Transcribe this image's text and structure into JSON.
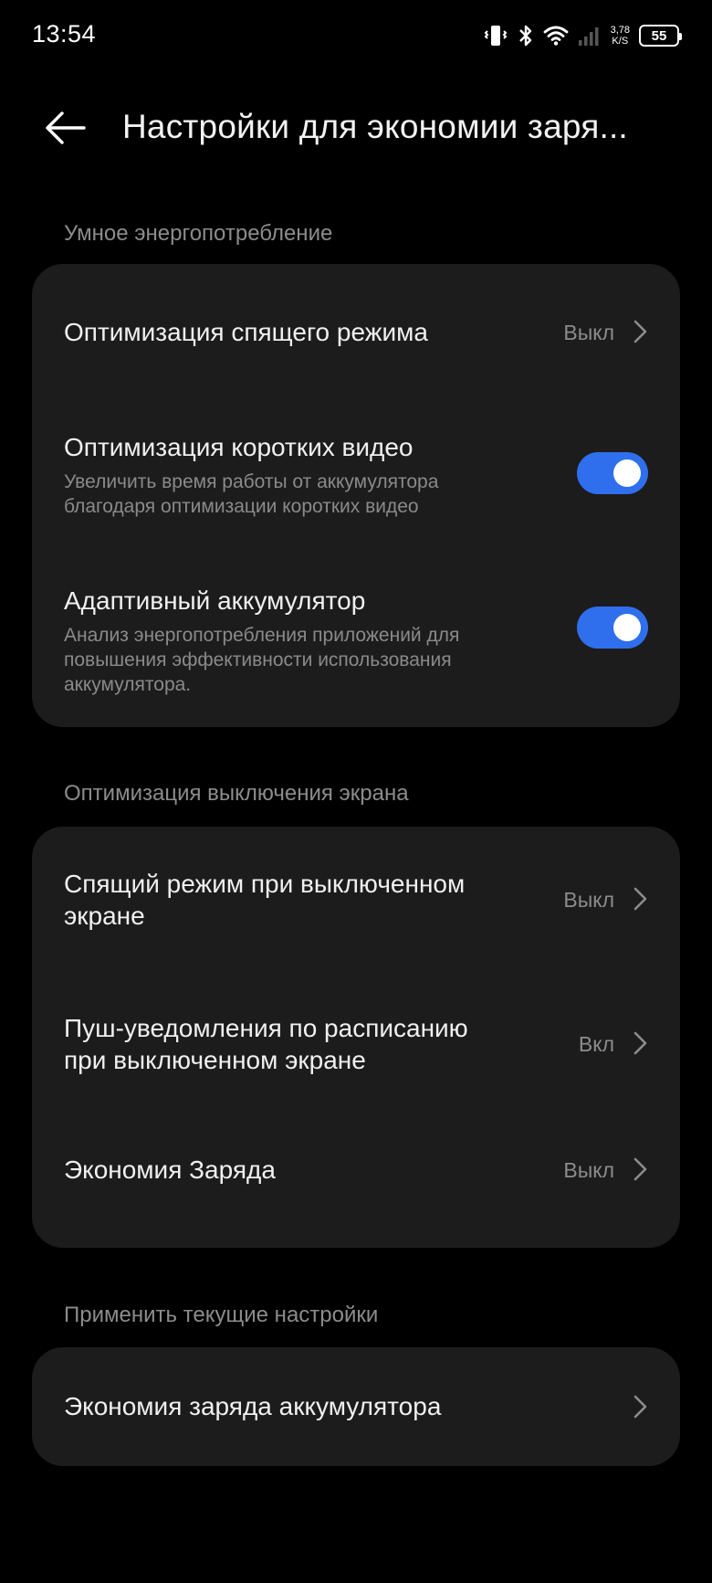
{
  "status_bar": {
    "time": "13:54",
    "net_speed_value": "3,78",
    "net_speed_unit": "K/S",
    "battery_level": "55",
    "icons": [
      "vibrate-icon",
      "bluetooth-icon",
      "wifi-icon",
      "signal-icon",
      "battery-icon"
    ]
  },
  "header": {
    "title": "Настройки для экономии заря..."
  },
  "sections": [
    {
      "title": "Умное энергопотребление",
      "items": [
        {
          "title": "Оптимизация спящего режима",
          "value": "Выкл",
          "control": "chevron"
        },
        {
          "title": "Оптимизация коротких видео",
          "subtitle_lines": [
            "Увеличить время работы от аккумулятора",
            "благодаря оптимизации коротких видео"
          ],
          "control": "toggle",
          "toggle_on": true
        },
        {
          "title": "Адаптивный аккумулятор",
          "subtitle_lines": [
            "Анализ энергопотребления приложений для",
            "повышения эффективности использования",
            "аккумулятора."
          ],
          "control": "toggle",
          "toggle_on": true
        }
      ]
    },
    {
      "title": "Оптимизация выключения экрана",
      "items": [
        {
          "title_lines": [
            "Спящий режим при выключенном",
            "экране"
          ],
          "value": "Выкл",
          "control": "chevron"
        },
        {
          "title_lines": [
            "Пуш-уведомления по расписанию",
            "при выключенном экране"
          ],
          "value": "Вкл",
          "control": "chevron"
        },
        {
          "title": "Экономия Заряда",
          "value": "Выкл",
          "control": "chevron"
        }
      ]
    },
    {
      "title": "Применить текущие настройки",
      "items": [
        {
          "title": "Экономия заряда аккумулятора",
          "control": "chevron"
        }
      ]
    }
  ],
  "colors": {
    "background": "#000000",
    "card": "#1c1c1c",
    "accent_toggle": "#2f6fed",
    "secondary_text": "#8c8c8c"
  }
}
